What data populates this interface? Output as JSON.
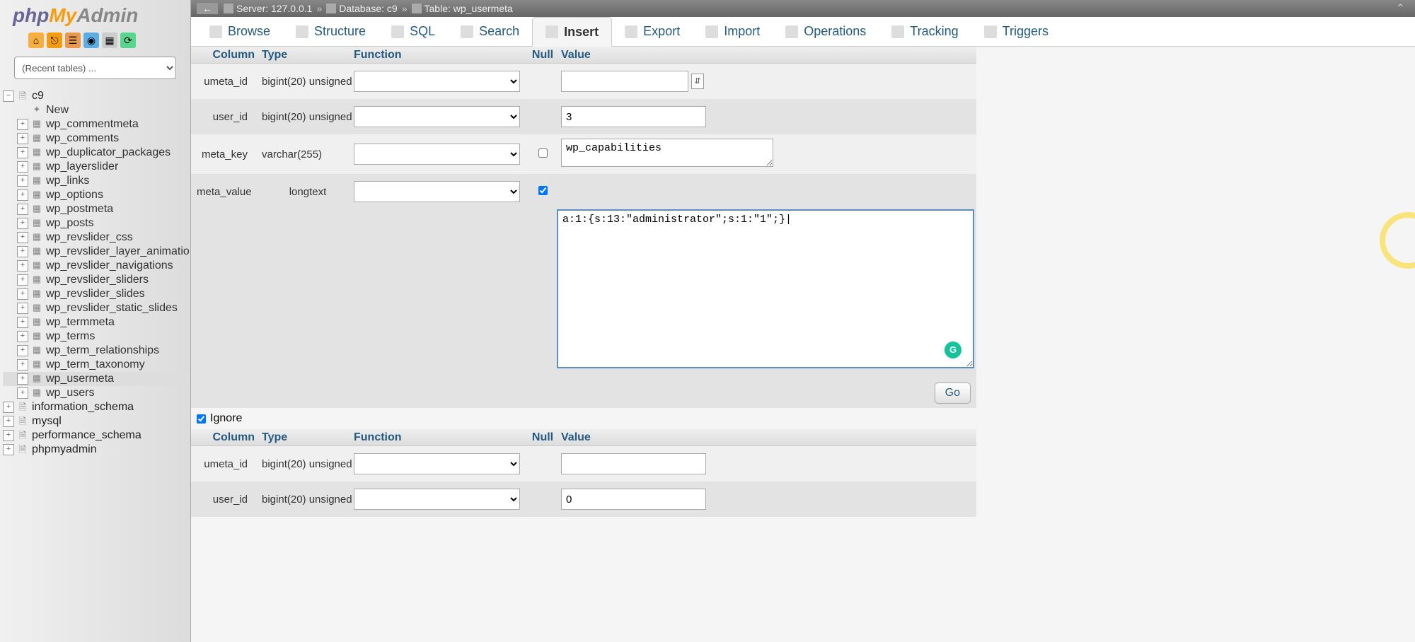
{
  "logo": {
    "php": "php",
    "my": "My",
    "admin": "Admin"
  },
  "recent_placeholder": "(Recent tables) ...",
  "breadcrumb": {
    "server_label": "Server:",
    "server_val": "127.0.0.1",
    "db_label": "Database:",
    "db_val": "c9",
    "table_label": "Table:",
    "table_val": "wp_usermeta"
  },
  "tabs": [
    "Browse",
    "Structure",
    "SQL",
    "Search",
    "Insert",
    "Export",
    "Import",
    "Operations",
    "Tracking",
    "Triggers"
  ],
  "active_tab": "Insert",
  "headers": {
    "column": "Column",
    "type": "Type",
    "function": "Function",
    "null": "Null",
    "value": "Value"
  },
  "rows1": [
    {
      "col": "umeta_id",
      "type": "bigint(20) unsigned",
      "null_check": false,
      "value": "",
      "has_icon": true,
      "style": "odd"
    },
    {
      "col": "user_id",
      "type": "bigint(20) unsigned",
      "null_check": false,
      "value": "3",
      "style": "even"
    },
    {
      "col": "meta_key",
      "type": "varchar(255)",
      "null_check_visible": true,
      "null_check": false,
      "value": "wp_capabilities",
      "textarea": "small",
      "style": "odd"
    },
    {
      "col": "meta_value",
      "type": "longtext",
      "null_check_visible": true,
      "null_check": true,
      "value": "a:1:{s:13:\"administrator\";s:1:\"1\";}|",
      "textarea": "large",
      "style": "even"
    }
  ],
  "go_label": "Go",
  "ignore_label": "Ignore",
  "ignore_checked": true,
  "rows2": [
    {
      "col": "umeta_id",
      "type": "bigint(20) unsigned",
      "value": "",
      "style": "odd"
    },
    {
      "col": "user_id",
      "type": "bigint(20) unsigned",
      "value": "0",
      "style": "even"
    }
  ],
  "sidebar_tree": {
    "current_db": "c9",
    "new_label": "New",
    "tables": [
      "wp_commentmeta",
      "wp_comments",
      "wp_duplicator_packages",
      "wp_layerslider",
      "wp_links",
      "wp_options",
      "wp_postmeta",
      "wp_posts",
      "wp_revslider_css",
      "wp_revslider_layer_animatio",
      "wp_revslider_navigations",
      "wp_revslider_sliders",
      "wp_revslider_slides",
      "wp_revslider_static_slides",
      "wp_termmeta",
      "wp_terms",
      "wp_term_relationships",
      "wp_term_taxonomy",
      "wp_usermeta",
      "wp_users"
    ],
    "active_table": "wp_usermeta",
    "other_dbs": [
      "information_schema",
      "mysql",
      "performance_schema",
      "phpmyadmin"
    ]
  }
}
